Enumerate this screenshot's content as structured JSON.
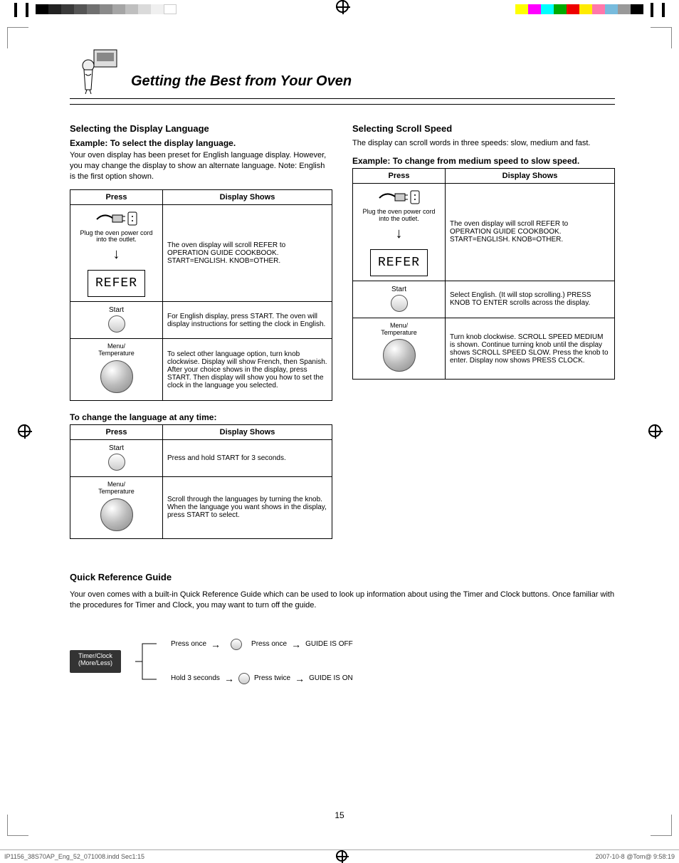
{
  "title": "Getting the Best from Your Oven",
  "left": {
    "heading": "Selecting the Display Language",
    "sub": "Example: To select the display language.",
    "para": "Your oven display has been preset for English language display. However, you may change the display to show an alternate language. Note: English is the first option shown.",
    "table": {
      "h1": "Press",
      "h2": "Display Shows",
      "r1b": "Plug the oven power cord into the outlet.",
      "displayWord": "REFER",
      "r1c": "The oven display will scroll REFER to OPERATION GUIDE COOKBOOK. START=ENGLISH. KNOB=OTHER.",
      "r2b": "For English display, press START. The oven will display instructions for setting the clock in English.",
      "r3b": "To select other language option, turn knob clockwise. Display will show French, then Spanish. After your choice shows in the display, press START. Then display will show you how to set the clock in the language you selected."
    },
    "sub2": "To change the language at any time:",
    "table2": {
      "h1": "Press",
      "h2": "Display Shows",
      "r1b": "Press and hold START for 3 seconds.",
      "r2b": "Scroll through the languages by turning the knob. When the language you want shows in the display, press START to select."
    }
  },
  "right": {
    "heading": "Selecting Scroll Speed",
    "para": "The display can scroll words in three speeds: slow, medium and fast.",
    "sub": "Example: To change from medium speed to slow speed.",
    "table": {
      "h1": "Press",
      "h2": "Display Shows",
      "r1b": "Plug the oven power cord into the outlet.",
      "displayWord": "REFER",
      "r1c": "The oven display will scroll REFER to OPERATION GUIDE COOKBOOK. START=ENGLISH. KNOB=OTHER.",
      "r2b": "Select English. (It will stop scrolling.) PRESS KNOB TO ENTER scrolls across the display.",
      "r3b": "Turn knob clockwise. SCROLL SPEED MEDIUM is shown. Continue turning knob until the display shows SCROLL SPEED SLOW. Press the knob to enter. Display now shows PRESS CLOCK."
    }
  },
  "quickref": {
    "heading": "Quick Reference Guide",
    "para": "Your oven comes with a built-in Quick Reference Guide which can be used to look up information about using the Timer and Clock buttons. Once familiar with the procedures for Timer and Clock, you may want to turn off the guide.",
    "btn": "Timer/Clock\n(More/Less)",
    "rows": {
      "r1a": "Press once",
      "r1b": "Press once",
      "r1c": "GUIDE IS OFF",
      "r2a": "Hold 3 seconds",
      "r2b": "Press twice",
      "r2c": "GUIDE IS ON"
    }
  },
  "buttons": {
    "start": "Start",
    "menuTemp": "Menu/\nTemperature"
  },
  "pageNumber": "15",
  "footer": {
    "left": "IP1156_38S70AP_Eng_52_071008.indd   Sec1:15",
    "right": "2007-10-8   @Tom@ 9:58:19"
  }
}
